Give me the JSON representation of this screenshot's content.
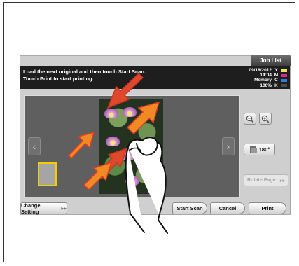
{
  "header": {
    "job_list": "Job List"
  },
  "message": {
    "line1": "Load the next original and then touch Start Scan.",
    "line2": "Touch Print to start printing."
  },
  "status": {
    "date": "09/18/2012",
    "time": "14:04",
    "memory_label": "Memory",
    "memory_value": "100%",
    "toner": [
      {
        "letter": "Y",
        "color": "#f3e34a"
      },
      {
        "letter": "M",
        "color": "#d52b8e"
      },
      {
        "letter": "C",
        "color": "#2e7fd9"
      },
      {
        "letter": "K",
        "color": "#4b4b4b"
      }
    ]
  },
  "preview": {
    "prev_icon": "chevron-left-icon",
    "next_icon": "chevron-right-icon",
    "zoom_out_icon": "zoom-out-icon",
    "zoom_in_icon": "zoom-in-icon",
    "rotate_label": "180°",
    "rotate_page_label": "Rotate Page",
    "rotate_page_arrow": "▸▸"
  },
  "footer": {
    "change_setting": "Change Setting",
    "change_setting_arrow": "▸▸",
    "start_scan": "Start Scan",
    "cancel": "Cancel",
    "print": "Print"
  },
  "overlay": {
    "gesture": "pinch-zoom-hand-icon",
    "arrow_color": "#f28a24",
    "arrow_stroke": "#d93b2d"
  }
}
